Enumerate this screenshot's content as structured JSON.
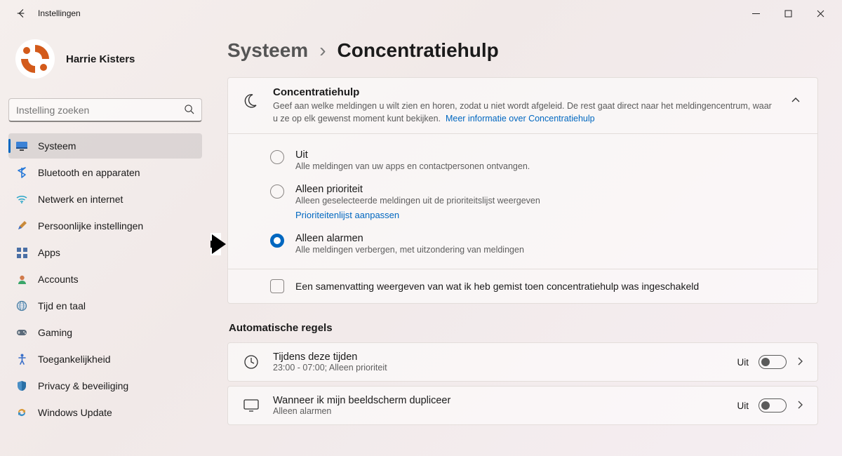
{
  "titlebar": {
    "app_title": "Instellingen"
  },
  "user": {
    "name": "Harrie Kisters"
  },
  "search": {
    "placeholder": "Instelling zoeken"
  },
  "sidebar": {
    "items": [
      {
        "label": "Systeem",
        "icon": "display",
        "active": true
      },
      {
        "label": "Bluetooth en apparaten",
        "icon": "bluetooth"
      },
      {
        "label": "Netwerk en internet",
        "icon": "wifi"
      },
      {
        "label": "Persoonlijke instellingen",
        "icon": "brush"
      },
      {
        "label": "Apps",
        "icon": "apps"
      },
      {
        "label": "Accounts",
        "icon": "account"
      },
      {
        "label": "Tijd en taal",
        "icon": "globe"
      },
      {
        "label": "Gaming",
        "icon": "gaming"
      },
      {
        "label": "Toegankelijkheid",
        "icon": "accessibility"
      },
      {
        "label": "Privacy & beveiliging",
        "icon": "shield"
      },
      {
        "label": "Windows Update",
        "icon": "update"
      }
    ]
  },
  "breadcrumb": {
    "parent": "Systeem",
    "current": "Concentratiehulp"
  },
  "panel": {
    "title": "Concentratiehulp",
    "desc": "Geef aan welke meldingen u wilt zien en horen, zodat u niet wordt afgeleid. De rest gaat direct naar het meldingencentrum, waar u ze op elk gewenst moment kunt bekijken.",
    "link": "Meer informatie over Concentratiehulp"
  },
  "radios": [
    {
      "label": "Uit",
      "sub": "Alle meldingen van uw apps en contactpersonen ontvangen.",
      "checked": false
    },
    {
      "label": "Alleen prioriteit",
      "sub": "Alleen geselecteerde meldingen uit de prioriteitslijst weergeven",
      "link": "Prioriteitenlijst aanpassen",
      "checked": false
    },
    {
      "label": "Alleen alarmen",
      "sub": "Alle meldingen verbergen, met uitzondering van meldingen",
      "checked": true
    }
  ],
  "checkbox": {
    "label": "Een samenvatting weergeven van wat ik heb gemist toen concentratiehulp was ingeschakeld",
    "checked": false
  },
  "section_title": "Automatische regels",
  "rules": [
    {
      "title": "Tijdens deze tijden",
      "sub": "23:00 - 07:00; Alleen prioriteit",
      "state": "Uit",
      "icon": "clock"
    },
    {
      "title": "Wanneer ik mijn beeldscherm dupliceer",
      "sub": "Alleen alarmen",
      "state": "Uit",
      "icon": "display"
    }
  ]
}
